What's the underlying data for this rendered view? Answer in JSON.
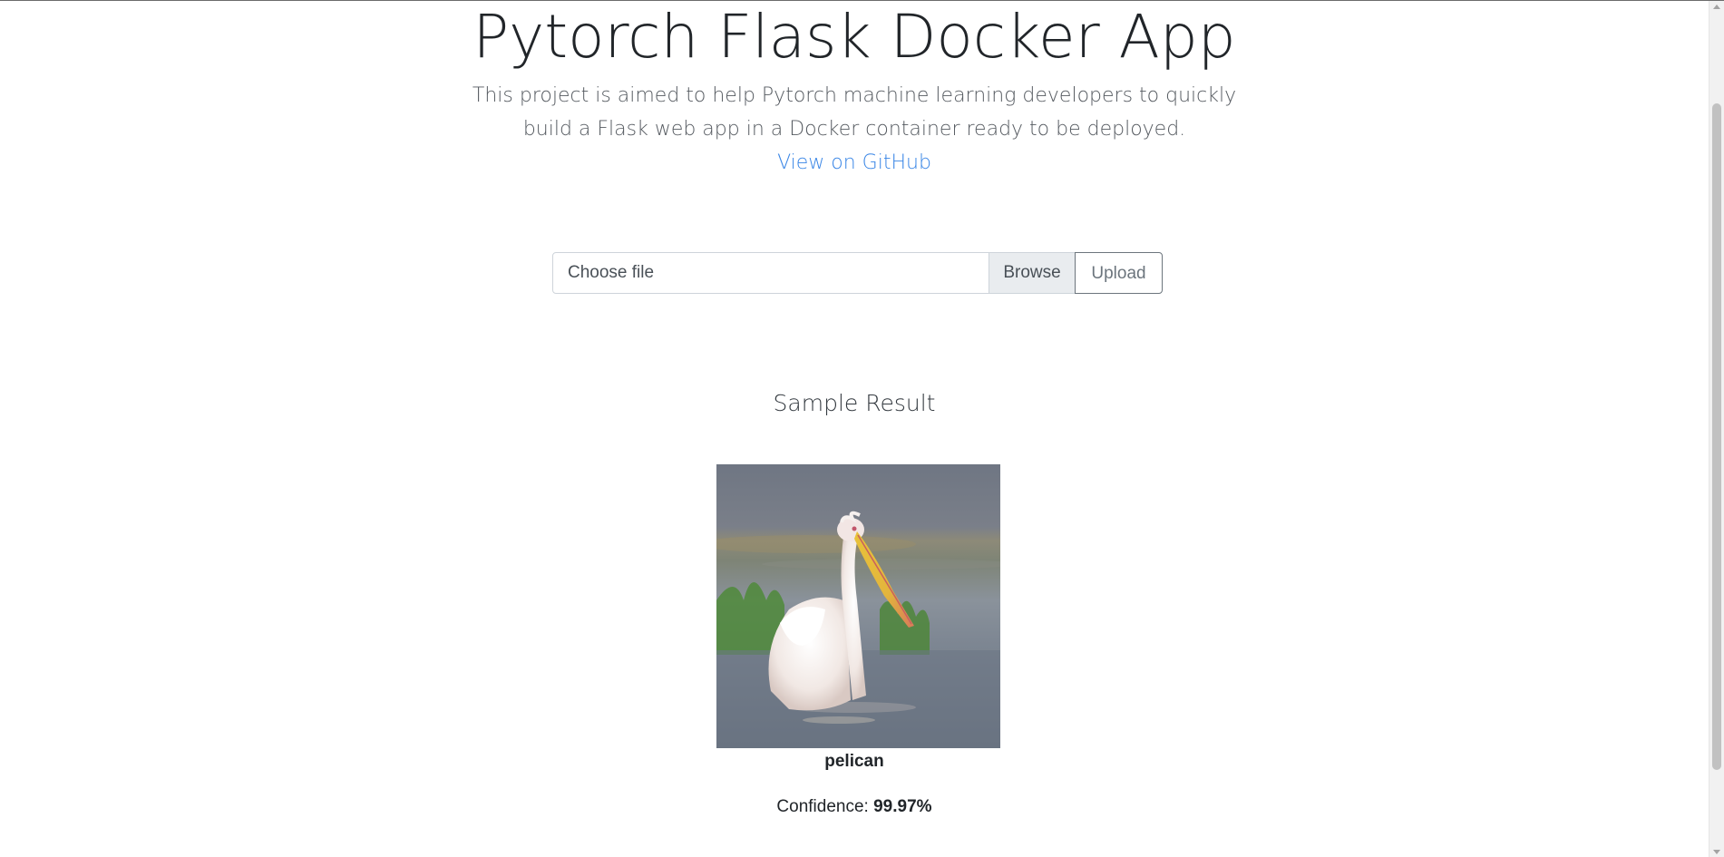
{
  "header": {
    "title": "Pytorch Flask Docker App",
    "description": "This project is aimed to help Pytorch machine learning developers to quickly build a Flask web app in a Docker container ready to be deployed.",
    "github_link": "View on GitHub"
  },
  "upload": {
    "file_placeholder": "Choose file",
    "browse_label": "Browse",
    "upload_label": "Upload"
  },
  "sample": {
    "heading": "Sample Result",
    "image_alt": "pelican",
    "class_name": "pelican",
    "confidence_label": "Confidence:",
    "confidence_value": "99.97%"
  },
  "colors": {
    "link": "#3a86e6",
    "text": "#212529",
    "muted": "#6c757d"
  }
}
